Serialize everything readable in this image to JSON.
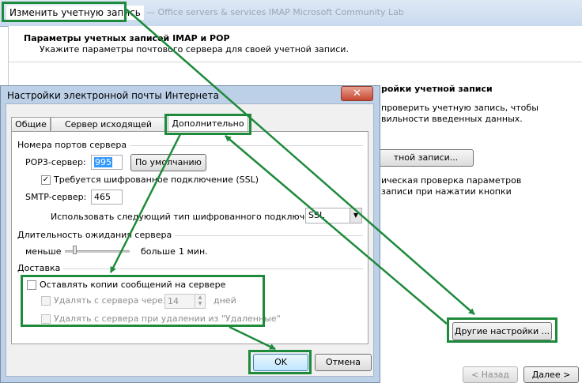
{
  "wizard": {
    "title": "Изменить учетную запись",
    "faded_title": "— Office servers & services IMAP Microsoft Community Lab",
    "heading": "Параметры учетных записей IMAP и POP",
    "subheading": "Укажите параметры почтового сервера для своей учетной записи.",
    "right_heading": "ройки учетной записи",
    "right_text_1": "проверить учетную запись, чтобы",
    "right_text_2": "вильности введенных данных.",
    "test_button": "тной записи...",
    "right_text_3": "ическая проверка параметров",
    "right_text_4": "записи при нажатии кнопки",
    "more_settings_button": "Другие настройки ...",
    "back_button": "< Назад",
    "next_button": "Далее >"
  },
  "dialog": {
    "title": "Настройки электронной почты Интернета",
    "close_glyph": "✕",
    "tabs": [
      {
        "label": "Общие"
      },
      {
        "label": "Сервер исходящей почты"
      },
      {
        "label": "Дополнительно"
      }
    ],
    "ports": {
      "group_label": "Номера портов сервера",
      "pop3_label": "POP3-сервер:",
      "pop3_value": "995",
      "default_button": "По умолчанию",
      "ssl_checkbox_label": "Требуется шифрованное подключение (SSL)",
      "ssl_checked": true,
      "smtp_label": "SMTP-сервер:",
      "smtp_value": "465",
      "encryption_label": "Использовать следующий тип шифрованного подключения:",
      "encryption_value": "SSL"
    },
    "timeout": {
      "group_label": "Длительность ожидания сервера",
      "less_label": "меньше",
      "more_label": "больше",
      "value_label": "1 мин.",
      "slider_level": 0.05
    },
    "delivery": {
      "group_label": "Доставка",
      "keep_copies_label": "Оставлять копии сообщений на сервере",
      "remove_after_label": "Удалять с сервера через",
      "days_value": "14",
      "days_label": "дней",
      "remove_deleted_label": "Удалять с сервера при удалении из \"Удаленные\""
    },
    "ok_button": "OK",
    "cancel_button": "Отмена"
  },
  "colors": {
    "highlight": "#1e8a3c",
    "dialog_frame": "#bcd0e8",
    "close_button": "#c6472f"
  }
}
